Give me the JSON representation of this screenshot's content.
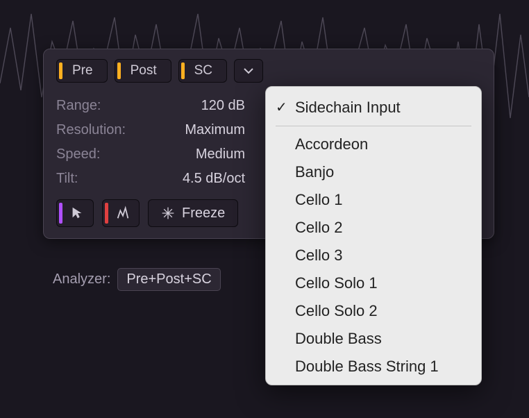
{
  "tabs": {
    "pre": "Pre",
    "post": "Post",
    "sc": "SC"
  },
  "params": {
    "range_label": "Range:",
    "range_value": "120 dB",
    "resolution_label": "Resolution:",
    "resolution_value": "Maximum",
    "speed_label": "Speed:",
    "speed_value": "Medium",
    "tilt_label": "Tilt:",
    "tilt_value": "4.5 dB/oct"
  },
  "toolbar": {
    "freeze_label": "Freeze"
  },
  "analyzer": {
    "label": "Analyzer:",
    "value": "Pre+Post+SC"
  },
  "menu": {
    "selected": "Sidechain Input",
    "items": [
      "Accordeon",
      "Banjo",
      "Cello 1",
      "Cello 2",
      "Cello 3",
      "Cello Solo 1",
      "Cello Solo 2",
      "Double Bass",
      "Double Bass String 1"
    ]
  },
  "colors": {
    "accent_orange": "#ffb020",
    "accent_purple": "#b050ff",
    "accent_red": "#e04040"
  }
}
